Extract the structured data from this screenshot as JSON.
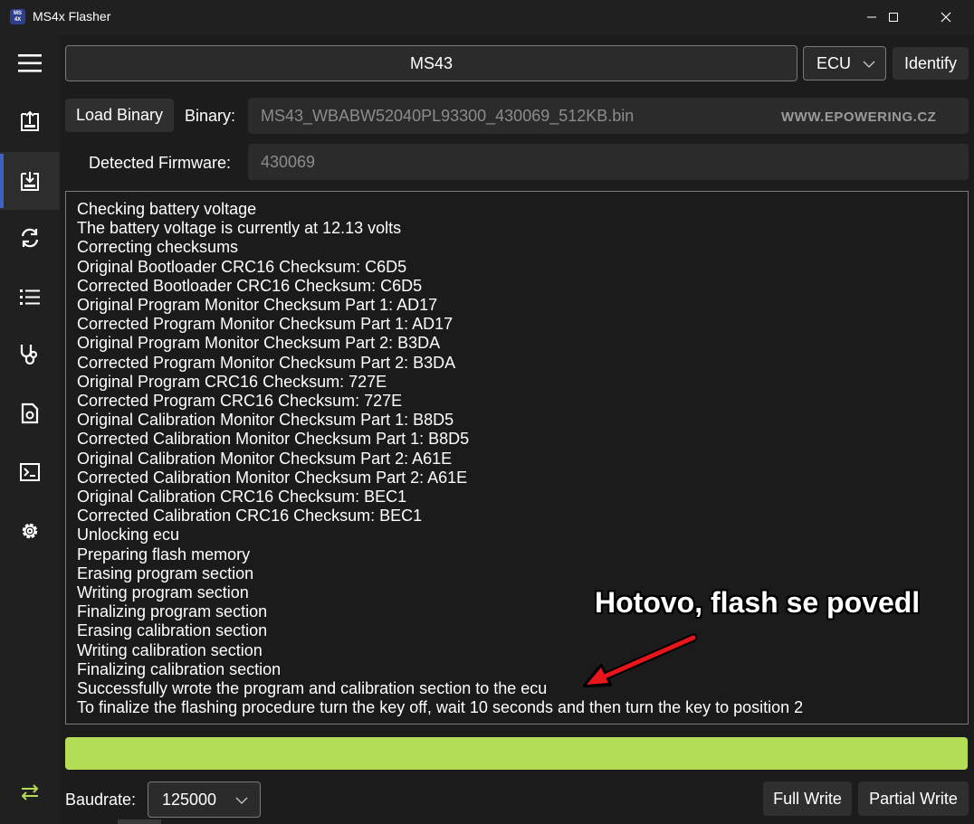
{
  "window": {
    "app_icon_line1": "MS",
    "app_icon_line2": "4X",
    "title": "MS4x Flasher"
  },
  "sidebar": {
    "items": [
      {
        "icon": "menu-icon"
      },
      {
        "icon": "read-icon"
      },
      {
        "icon": "write-icon",
        "active": true
      },
      {
        "icon": "refresh-icon"
      },
      {
        "icon": "list-icon"
      },
      {
        "icon": "stethoscope-icon"
      },
      {
        "icon": "file-icon"
      },
      {
        "icon": "terminal-icon"
      },
      {
        "icon": "settings-icon"
      },
      {
        "icon": "swap-icon"
      }
    ]
  },
  "header": {
    "ecu_name": "MS43",
    "ecu_select": "ECU",
    "identify_label": "Identify"
  },
  "binary": {
    "load_label": "Load Binary",
    "binary_label": "Binary:",
    "binary_value": "MS43_WBABW52040PL93300_430069_512KB.bin",
    "watermark": "WWW.EPOWERING.CZ"
  },
  "firmware": {
    "label": "Detected Firmware:",
    "value": "430069"
  },
  "log": [
    "Checking battery voltage",
    "The battery voltage is currently at 12.13 volts",
    "Correcting checksums",
    "Original Bootloader CRC16 Checksum: C6D5",
    "Corrected Bootloader CRC16 Checksum: C6D5",
    "Original Program Monitor Checksum Part 1: AD17",
    "Corrected Program Monitor Checksum Part 1: AD17",
    "Original Program Monitor Checksum Part 2: B3DA",
    "Corrected Program Monitor Checksum Part 2: B3DA",
    "Original Program CRC16 Checksum: 727E",
    "Corrected Program CRC16 Checksum: 727E",
    "Original Calibration Monitor Checksum Part 1: B8D5",
    "Corrected Calibration Monitor Checksum Part 1: B8D5",
    "Original Calibration Monitor Checksum Part 2: A61E",
    "Corrected Calibration Monitor Checksum Part 2: A61E",
    "Original Calibration CRC16 Checksum: BEC1",
    "Corrected Calibration CRC16 Checksum: BEC1",
    "Unlocking ecu",
    "Preparing flash memory",
    "Erasing program section",
    "Writing program section",
    "Finalizing program section",
    "Erasing calibration section",
    "Writing calibration section",
    "Finalizing calibration section",
    "Successfully wrote the program and calibration section to the ecu",
    "To finalize the flashing procedure turn the key off, wait 10 seconds and then turn the key to position 2"
  ],
  "annotation": "Hotovo, flash se povedl",
  "progress": {
    "percent": 100,
    "color": "#b4dc55"
  },
  "footer": {
    "baudrate_label": "Baudrate:",
    "baudrate_value": "125000",
    "full_write_label": "Full Write",
    "partial_write_label": "Partial Write"
  },
  "colors": {
    "accent": "#3d62c7",
    "arrow": "#e8161b",
    "swap_icon": "#b4dc55"
  }
}
